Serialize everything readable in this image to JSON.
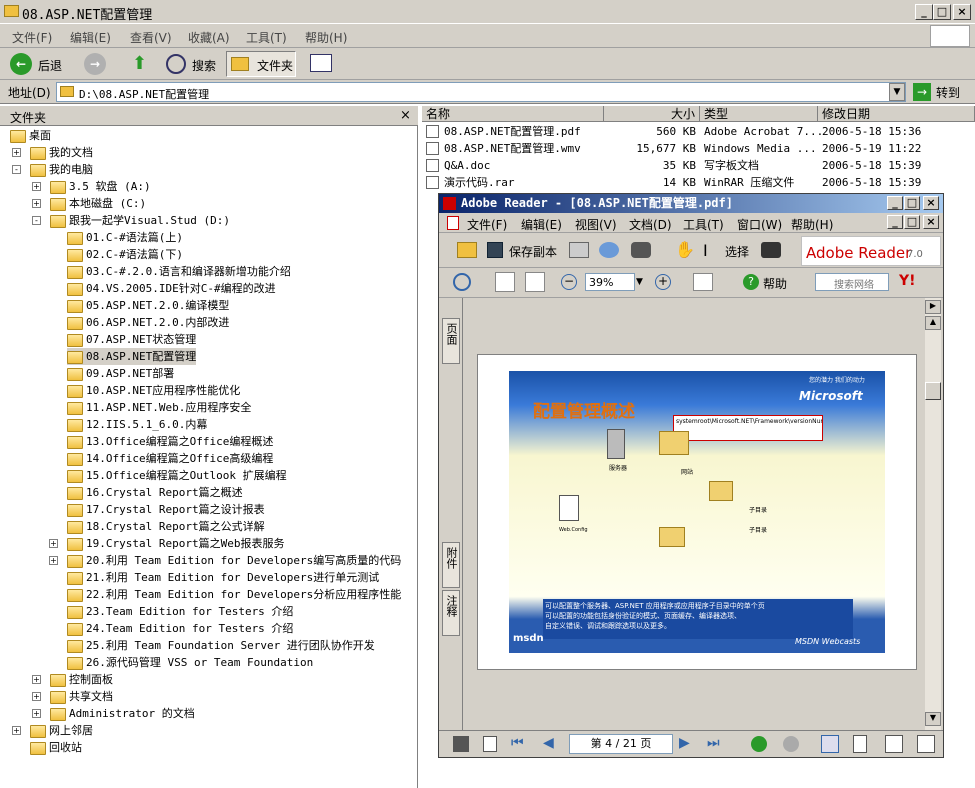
{
  "window": {
    "title": "08.ASP.NET配置管理"
  },
  "menu": [
    "文件(F)",
    "编辑(E)",
    "查看(V)",
    "收藏(A)",
    "工具(T)",
    "帮助(H)"
  ],
  "toolbar": {
    "back": "后退",
    "search": "搜索",
    "folders": "文件夹"
  },
  "address": {
    "label": "地址(D)",
    "value": "D:\\08.ASP.NET配置管理",
    "go": "转到"
  },
  "folders_panel": {
    "title": "文件夹"
  },
  "tree": [
    {
      "label": "桌面",
      "level": 0
    },
    {
      "label": "我的文档",
      "level": 1,
      "exp": "+"
    },
    {
      "label": "我的电脑",
      "level": 1,
      "exp": "-"
    },
    {
      "label": "3.5 软盘 (A:)",
      "level": 2,
      "exp": "+"
    },
    {
      "label": "本地磁盘 (C:)",
      "level": 2,
      "exp": "+"
    },
    {
      "label": "跟我一起学Visual.Stud (D:)",
      "level": 2,
      "exp": "-"
    },
    {
      "label": "01.C-#语法篇(上)",
      "level": 3
    },
    {
      "label": "02.C-#语法篇(下)",
      "level": 3
    },
    {
      "label": "03.C-#.2.0.语言和编译器新增功能介绍",
      "level": 3
    },
    {
      "label": "04.VS.2005.IDE针对C-#编程的改进",
      "level": 3
    },
    {
      "label": "05.ASP.NET.2.0.编译模型",
      "level": 3
    },
    {
      "label": "06.ASP.NET.2.0.内部改进",
      "level": 3
    },
    {
      "label": "07.ASP.NET状态管理",
      "level": 3
    },
    {
      "label": "08.ASP.NET配置管理",
      "level": 3,
      "selected": true
    },
    {
      "label": "09.ASP.NET部署",
      "level": 3
    },
    {
      "label": "10.ASP.NET应用程序性能优化",
      "level": 3
    },
    {
      "label": "11.ASP.NET.Web.应用程序安全",
      "level": 3
    },
    {
      "label": "12.IIS.5.1_6.0.内幕",
      "level": 3
    },
    {
      "label": "13.Office编程篇之Office编程概述",
      "level": 3
    },
    {
      "label": "14.Office编程篇之Office高级编程",
      "level": 3
    },
    {
      "label": "15.Office编程篇之Outlook 扩展编程",
      "level": 3
    },
    {
      "label": "16.Crystal Report篇之概述",
      "level": 3
    },
    {
      "label": "17.Crystal Report篇之设计报表",
      "level": 3
    },
    {
      "label": "18.Crystal Report篇之公式详解",
      "level": 3
    },
    {
      "label": "19.Crystal Report篇之Web报表服务",
      "level": 3,
      "exp": "+"
    },
    {
      "label": "20.利用 Team Edition for Developers编写高质量的代码",
      "level": 3,
      "exp": "+"
    },
    {
      "label": "21.利用 Team Edition for Developers进行单元测试",
      "level": 3
    },
    {
      "label": "22.利用 Team Edition for Developers分析应用程序性能",
      "level": 3
    },
    {
      "label": "23.Team Edition for Testers 介绍",
      "level": 3
    },
    {
      "label": "24.Team Edition for Testers 介绍",
      "level": 3
    },
    {
      "label": "25.利用 Team Foundation Server 进行团队协作开发",
      "level": 3
    },
    {
      "label": "26.源代码管理 VSS or Team Foundation",
      "level": 3
    },
    {
      "label": "控制面板",
      "level": 2,
      "exp": "+"
    },
    {
      "label": "共享文档",
      "level": 2,
      "exp": "+"
    },
    {
      "label": "Administrator 的文档",
      "level": 2,
      "exp": "+"
    },
    {
      "label": "网上邻居",
      "level": 1,
      "exp": "+"
    },
    {
      "label": "回收站",
      "level": 1
    }
  ],
  "columns": [
    "名称",
    "大小",
    "类型",
    "修改日期"
  ],
  "files": [
    {
      "name": "08.ASP.NET配置管理.pdf",
      "size": "560 KB",
      "type": "Adobe Acrobat 7...",
      "date": "2006-5-18 15:36"
    },
    {
      "name": "08.ASP.NET配置管理.wmv",
      "size": "15,677 KB",
      "type": "Windows Media ...",
      "date": "2006-5-19 11:22"
    },
    {
      "name": "Q&A.doc",
      "size": "35 KB",
      "type": "写字板文档",
      "date": "2006-5-18 15:39"
    },
    {
      "name": "演示代码.rar",
      "size": "14 KB",
      "type": "WinRAR 压缩文件",
      "date": "2006-5-18 15:39"
    }
  ],
  "reader": {
    "title": "Adobe Reader - [08.ASP.NET配置管理.pdf]",
    "menu": [
      "文件(F)",
      "编辑(E)",
      "视图(V)",
      "文档(D)",
      "工具(T)",
      "窗口(W)",
      "帮助(H)"
    ],
    "save_copy": "保存副本",
    "select": "选择",
    "brand": "Adobe Reader",
    "version": "7.0",
    "zoom": "39%",
    "help": "帮助",
    "search_placeholder": "搜索网络",
    "tabs": [
      "页面",
      "附件",
      "注释"
    ],
    "page_indicator": "第 4 / 21 页",
    "slide": {
      "title": "配置管理概述",
      "path": "systemroot\\Microsoft.NET\\Framework\\versionNumber\\CONFIG\\Web.config",
      "server": "服务器",
      "site": "网站",
      "sub1": "子目录",
      "sub2": "子目录",
      "webconfig": "Web.Config",
      "caption": "可以配置整个服务器、ASP.NET 应用程序或应用程序子目录中的单个页\n可以配置的功能包括身份验证的模式、页面缓存、编译器选项、\n自定义错误、调试和跟踪选项以及更多。",
      "ms": "Microsoft",
      "tag": "您的潜力 我们的动力",
      "msdn": "msdn",
      "webcasts": "MSDN Webcasts"
    }
  }
}
